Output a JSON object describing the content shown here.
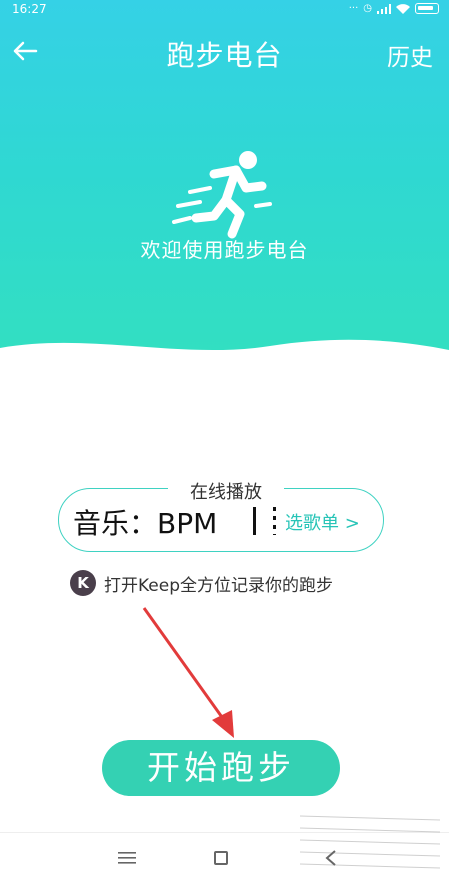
{
  "status": {
    "time": "16:27",
    "icons": [
      "alarm-icon",
      "signal-icon",
      "wifi-icon",
      "battery-icon"
    ]
  },
  "navbar": {
    "title": "跑步电台",
    "history_label": "历史"
  },
  "hero": {
    "welcome_text": "欢迎使用跑步电台"
  },
  "online": {
    "label": "在线播放",
    "music_text": "音乐：BPM",
    "choose_list_label": "选歌单 >"
  },
  "keep": {
    "logo_letter": "K",
    "text": "打开Keep全方位记录你的跑步"
  },
  "start_button_label": "开始跑步",
  "colors": {
    "hero_top": "#35d1e6",
    "hero_bottom": "#33e0bf",
    "accent": "#34d1b3",
    "link": "#27c4b7",
    "annotation_arrow": "#e23b3b"
  }
}
